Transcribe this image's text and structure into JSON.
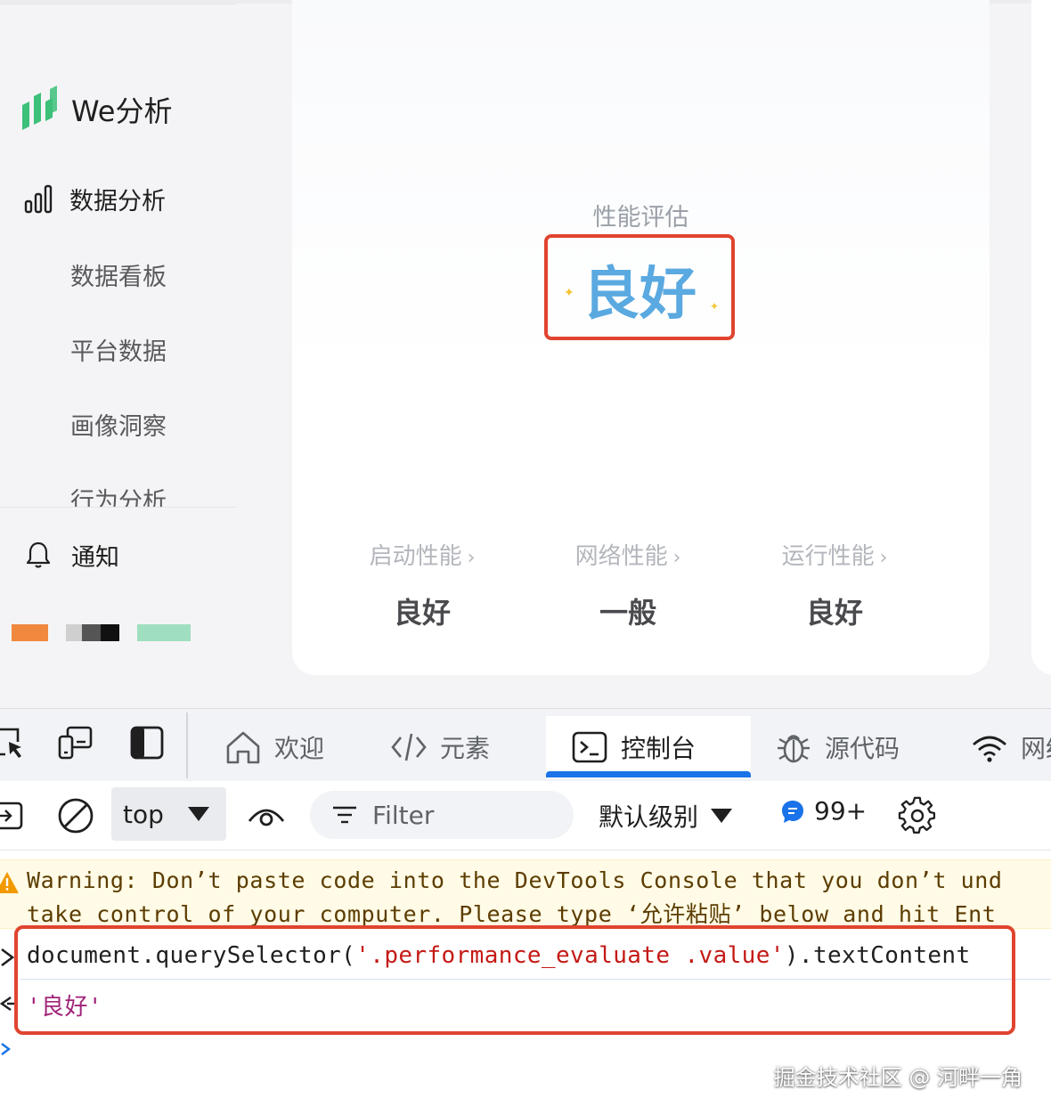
{
  "app": {
    "logo_text": "We分析",
    "nav": {
      "group_label": "数据分析",
      "items": [
        "数据看板",
        "平台数据",
        "画像洞察",
        "行为分析"
      ],
      "notice_label": "通知"
    }
  },
  "card": {
    "eval_label": "性能评估",
    "eval_value": "良好",
    "metrics": [
      {
        "title": "启动性能",
        "value": "良好"
      },
      {
        "title": "网络性能",
        "value": "一般"
      },
      {
        "title": "运行性能",
        "value": "良好"
      }
    ],
    "chevron": "›"
  },
  "devtools": {
    "tabs": [
      {
        "label": "欢迎",
        "icon": "home-icon"
      },
      {
        "label": "元素",
        "icon": "code-icon"
      },
      {
        "label": "控制台",
        "icon": "console-icon",
        "active": true
      },
      {
        "label": "源代码",
        "icon": "bug-icon"
      },
      {
        "label": "网络",
        "icon": "wifi-icon"
      }
    ],
    "toolbar": {
      "context": "top",
      "filter_placeholder": "Filter",
      "levels": "默认级别",
      "issues_count": "99+"
    },
    "console": {
      "warning_line1": "Warning: Don’t paste code into the DevTools Console that you don’t und",
      "warning_line2": "take control of your computer. Please type ‘允许粘贴’ below and hit Ent",
      "command_prefix": "document.querySelector(",
      "command_string": "'.performance_evaluate .value'",
      "command_suffix": ").textContent",
      "result": "'良好'"
    },
    "accent": "#1a73e8"
  },
  "watermark": "掘金技术社区 @ 河畔一角",
  "colors": {
    "highlight_box": "#e0442f",
    "eval_value": "#5aa9e0",
    "logo_green": "#3cc07a"
  }
}
